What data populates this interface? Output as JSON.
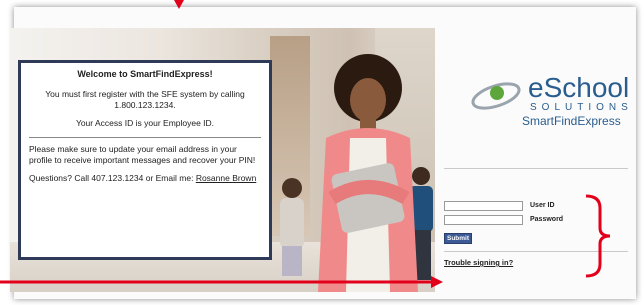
{
  "welcome": {
    "title": "Welcome to SmartFindExpress!",
    "register_line": "You must first register with the SFE system by calling",
    "phone": "1.800.123.1234.",
    "access_id": "Your Access ID is your Employee ID.",
    "update_note": "Please make sure to update your email address in your profile to receive important messages and recover your PIN!",
    "questions": "Questions? Call 407.123.1234 or Email me:",
    "contact_name": "Rosanne Brown"
  },
  "logo": {
    "e": "e",
    "school": "School",
    "solutions": "SOLUTIONS",
    "product": "SmartFindExpress"
  },
  "login": {
    "user_id_label": "User ID",
    "password_label": "Password",
    "user_id_value": "",
    "password_value": "",
    "submit_label": "Submit",
    "trouble_link": "Trouble signing in?"
  },
  "colors": {
    "annotation_red": "#e3001b",
    "panel_border": "#2f3a58",
    "submit_blue": "#3d5a96",
    "brand_blue": "#2a5d8f"
  }
}
